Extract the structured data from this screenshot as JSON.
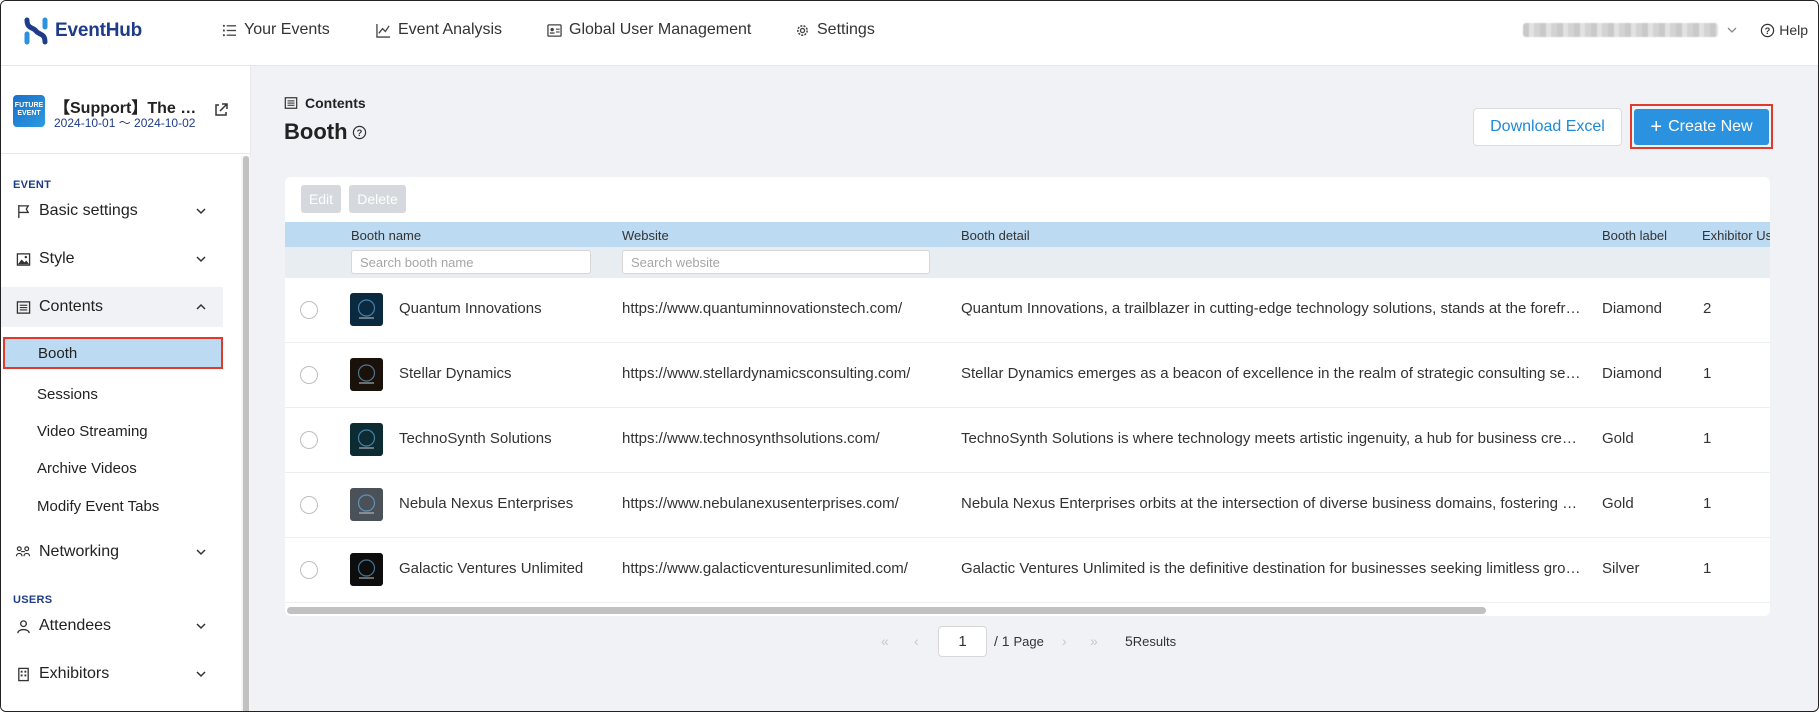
{
  "app": {
    "name": "EventHub",
    "help_label": "Help"
  },
  "topnav": [
    {
      "label": "Your Events",
      "icon": "list-icon"
    },
    {
      "label": "Event Analysis",
      "icon": "line-chart-icon"
    },
    {
      "label": "Global User Management",
      "icon": "id-card-icon"
    },
    {
      "label": "Settings",
      "icon": "gear-icon"
    }
  ],
  "event": {
    "title": "【Support】The F…",
    "dates": "2024-10-01 ～ 2024-10-02",
    "thumb_text": "FUTURE EVENT"
  },
  "sidebar": {
    "sections": [
      "EVENT",
      "USERS"
    ],
    "menu": [
      {
        "label": "Basic settings",
        "icon": "flag-icon",
        "state": "collapsed"
      },
      {
        "label": "Style",
        "icon": "image-icon",
        "state": "collapsed"
      },
      {
        "label": "Contents",
        "icon": "list-box-icon",
        "state": "expanded"
      },
      {
        "label": "Networking",
        "icon": "network-icon",
        "state": "collapsed"
      },
      {
        "label": "Attendees",
        "icon": "user-icon",
        "state": "collapsed"
      },
      {
        "label": "Exhibitors",
        "icon": "building-icon",
        "state": "collapsed"
      }
    ],
    "contents_sub": [
      "Booth",
      "Sessions",
      "Video Streaming",
      "Archive Videos",
      "Modify Event Tabs"
    ],
    "active_sub": "Booth"
  },
  "breadcrumb": "Contents",
  "page_title": "Booth",
  "buttons": {
    "download": "Download Excel",
    "create": "Create New",
    "edit": "Edit",
    "delete": "Delete"
  },
  "table": {
    "columns": [
      "Booth name",
      "Website",
      "Booth detail",
      "Booth label",
      "Exhibitor Us"
    ],
    "filters": {
      "booth_name_placeholder": "Search booth name",
      "website_placeholder": "Search website"
    },
    "rows": [
      {
        "name": "Quantum Innovations",
        "website": "https://www.quantuminnovationstech.com/",
        "detail": "Quantum Innovations, a trailblazer in cutting-edge technology solutions, stands at the forefront of innovation",
        "label": "Diamond",
        "exhibitors": "2",
        "logo_color": "#0b2a3f"
      },
      {
        "name": "Stellar Dynamics",
        "website": "https://www.stellardynamicsconsulting.com/",
        "detail": "Stellar Dynamics emerges as a beacon of excellence in the realm of strategic consulting services",
        "label": "Diamond",
        "exhibitors": "1",
        "logo_color": "#1a120a"
      },
      {
        "name": "TechnoSynth Solutions",
        "website": "https://www.technosynthsolutions.com/",
        "detail": "TechnoSynth Solutions is where technology meets artistic ingenuity, a hub for business creativity",
        "label": "Gold",
        "exhibitors": "1",
        "logo_color": "#0c2b33"
      },
      {
        "name": "Nebula Nexus Enterprises",
        "website": "https://www.nebulanexusenterprises.com/",
        "detail": "Nebula Nexus Enterprises orbits at the intersection of diverse business domains, fostering growth",
        "label": "Gold",
        "exhibitors": "1",
        "logo_color": "#4a5158"
      },
      {
        "name": "Galactic Ventures Unlimited",
        "website": "https://www.galacticventuresunlimited.com/",
        "detail": "Galactic Ventures Unlimited is the definitive destination for businesses seeking limitless growth",
        "label": "Silver",
        "exhibitors": "1",
        "logo_color": "#0d0d0d"
      }
    ]
  },
  "pagination": {
    "current": "1",
    "total_text": "/ 1",
    "page_label": "Page",
    "results_count": "5",
    "results_label": "Results"
  },
  "colors": {
    "brand": "#1f3c88",
    "accent": "#2a92de",
    "highlight": "#e03a2d",
    "header_row": "#bcdaf2"
  }
}
